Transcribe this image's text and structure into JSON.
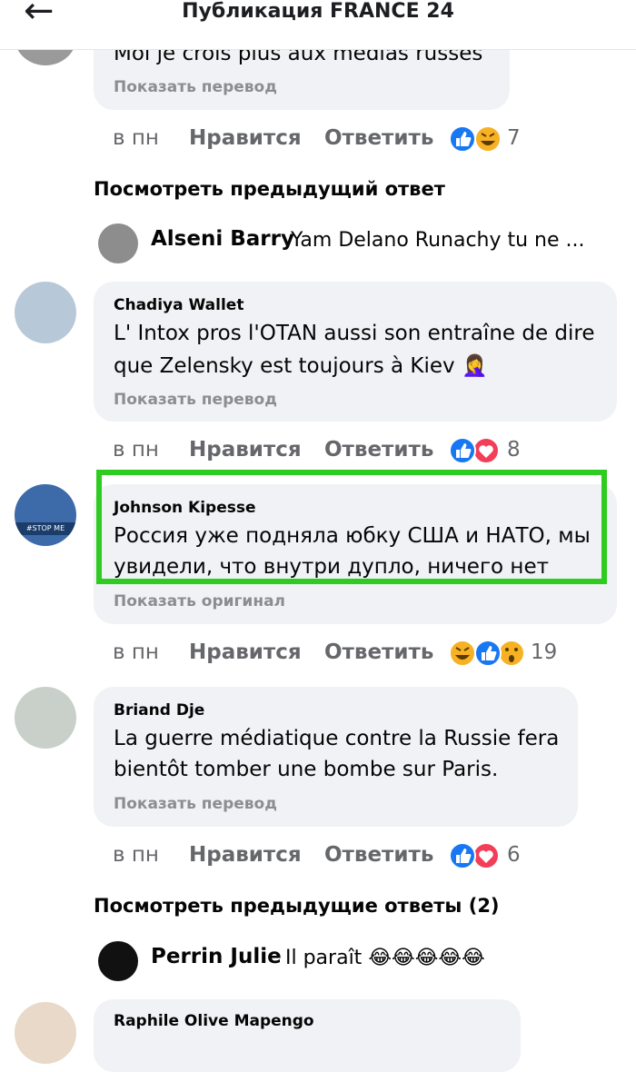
{
  "header": {
    "back_icon": "arrow-left-icon",
    "title": "Публикация FRANCE 24"
  },
  "colors": {
    "like_blue": "#1877f2",
    "love_red": "#f33e58",
    "haha_yellow": "#f7b125",
    "highlight_green": "#2ecc20"
  },
  "labels": {
    "like": "Нравится",
    "reply": "Ответить",
    "show_translation": "Показать перевод",
    "show_original": "Показать оригинал"
  },
  "comments": [
    {
      "author": "",
      "text": "Moi je crois plus aux médias russes",
      "translate": "Показать перевод",
      "time": "в пн",
      "like": "Нравится",
      "reply": "Ответить",
      "reactions": [
        "like",
        "haha"
      ],
      "count": "7"
    },
    {
      "author": "Chadiya Wallet",
      "line1": "L' Intox pros l'OTAN aussi son entraîne de dire",
      "line2": "que Zelensky est toujours à Kiev",
      "emoji": "🤦‍♀️",
      "translate": "Показать перевод",
      "time": "в пн",
      "like": "Нравится",
      "reply": "Ответить",
      "reactions": [
        "like",
        "love"
      ],
      "count": "8"
    },
    {
      "author": "Johnson Kipesse",
      "line1": "Россия уже подняла юбку США и НАТО, мы",
      "line2": "увидели, что внутри дупло, ничего нет",
      "translate": "Показать оригинал",
      "time": "в пн",
      "like": "Нравится",
      "reply": "Ответить",
      "reactions": [
        "haha",
        "like",
        "wow"
      ],
      "count": "19",
      "avatar_badge": "#STOP ME"
    },
    {
      "author": "Briand Dje",
      "line1": "La guerre médiatique contre la Russie fera",
      "line2": "bientôt tomber une bombe sur Paris.",
      "translate": "Показать перевод",
      "time": "в пн",
      "like": "Нравится",
      "reply": "Ответить",
      "reactions": [
        "like",
        "love"
      ],
      "count": "6"
    },
    {
      "author": "Raphile Olive Mapengo"
    }
  ],
  "view_previous_1": "Посмотреть предыдущий ответ",
  "view_previous_2": "Посмотреть предыдущие ответы (2)",
  "reply_preview_1": {
    "name": "Alseni Barry",
    "text": "Yam Delano Runachy tu ne ..."
  },
  "reply_preview_2": {
    "name": "Perrin Julie",
    "text": "Il paraît",
    "emojis": "😂😂😂😂😂"
  }
}
